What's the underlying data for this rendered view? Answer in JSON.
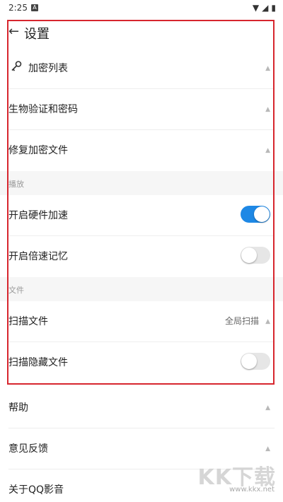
{
  "status": {
    "time": "2:25",
    "notification_icon": "A",
    "icons": [
      "wifi-icon",
      "signal-icon",
      "battery-icon"
    ]
  },
  "header": {
    "title": "设置"
  },
  "rows": {
    "encrypt_list": "加密列表",
    "biometric_password": "生物验证和密码",
    "repair_encrypted": "修复加密文件",
    "hardware_accel": "开启硬件加速",
    "speed_memory": "开启倍速记忆",
    "scan_files": "扫描文件",
    "scan_files_value": "全局扫描",
    "scan_hidden": "扫描隐藏文件",
    "help": "帮助",
    "feedback": "意见反馈",
    "about": "关于QQ影音"
  },
  "sections": {
    "playback": "播放",
    "files": "文件"
  },
  "toggles": {
    "hardware_accel": true,
    "speed_memory": false,
    "scan_hidden": false
  },
  "colors": {
    "accent": "#1e88e5",
    "highlight_frame": "#d7262e",
    "section_bg": "#f6f6f6"
  },
  "watermark": {
    "main": "KK下载",
    "sub": "www.kkx.net"
  }
}
